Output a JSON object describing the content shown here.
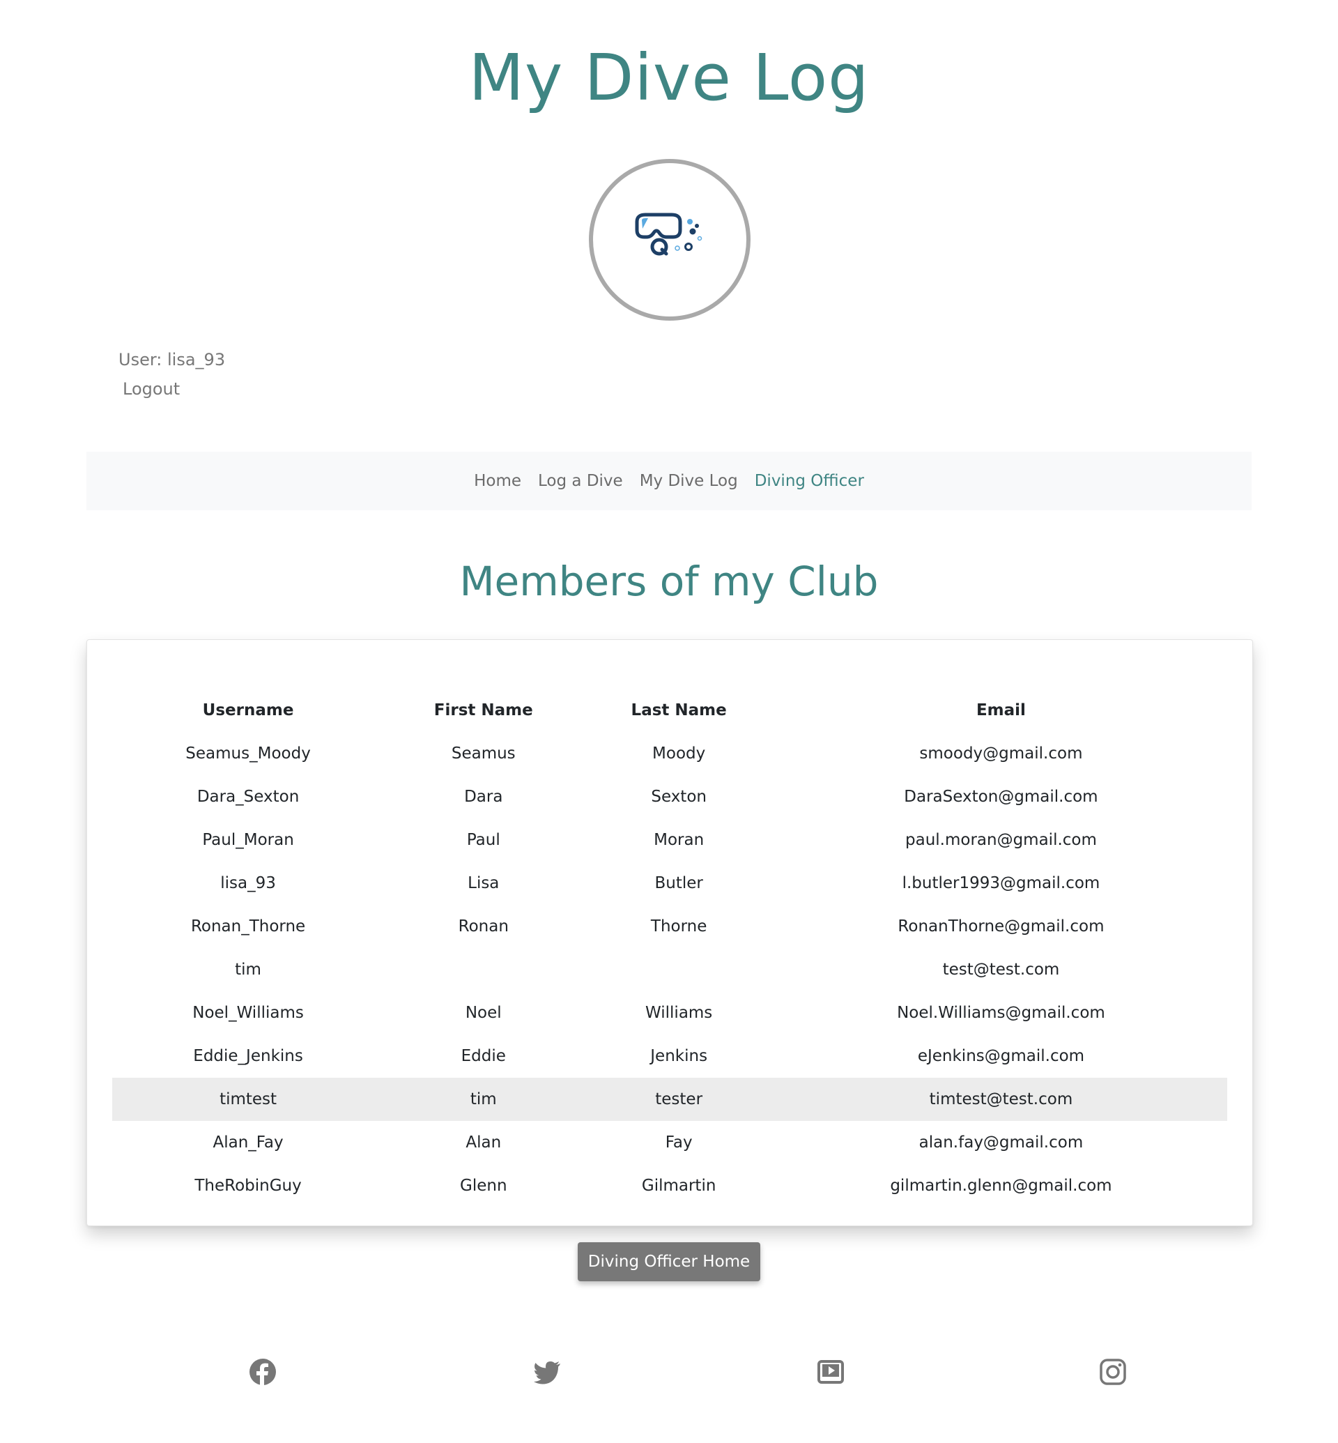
{
  "header": {
    "title": "My Dive Log"
  },
  "user": {
    "label": "User: lisa_93",
    "logout": "Logout"
  },
  "nav": {
    "items": [
      {
        "label": "Home"
      },
      {
        "label": "Log a Dive"
      },
      {
        "label": "My Dive Log"
      },
      {
        "label": "Diving Officer"
      }
    ],
    "active": "Diving Officer"
  },
  "main": {
    "title": "Members of my Club",
    "table": {
      "headers": [
        "Username",
        "First Name",
        "Last Name",
        "Email"
      ],
      "rows": [
        [
          "Seamus_Moody",
          "Seamus",
          "Moody",
          "smoody@gmail.com"
        ],
        [
          "Dara_Sexton",
          "Dara",
          "Sexton",
          "DaraSexton@gmail.com"
        ],
        [
          "Paul_Moran",
          "Paul",
          "Moran",
          "paul.moran@gmail.com"
        ],
        [
          "lisa_93",
          "Lisa",
          "Butler",
          "l.butler1993@gmail.com"
        ],
        [
          "Ronan_Thorne",
          "Ronan",
          "Thorne",
          "RonanThorne@gmail.com"
        ],
        [
          "tim",
          "",
          "",
          "test@test.com"
        ],
        [
          "Noel_Williams",
          "Noel",
          "Williams",
          "Noel.Williams@gmail.com"
        ],
        [
          "Eddie_Jenkins",
          "Eddie",
          "Jenkins",
          "eJenkins@gmail.com"
        ],
        [
          "timtest",
          "tim",
          "tester",
          "timtest@test.com"
        ],
        [
          "Alan_Fay",
          "Alan",
          "Fay",
          "alan.fay@gmail.com"
        ],
        [
          "TheRobinGuy",
          "Glenn",
          "Gilmartin",
          "gilmartin.glenn@gmail.com"
        ]
      ],
      "highlighted_row": "timtest"
    },
    "button_label": "Diving Officer Home"
  },
  "footer": {
    "icons": [
      "facebook-icon",
      "twitter-icon",
      "youtube-icon",
      "instagram-icon"
    ]
  },
  "colors": {
    "accent": "#3f8583",
    "nav_bg": "#f8f9fa",
    "button_bg": "#787878",
    "icon_gray": "#777777",
    "row_highlight": "#ececec"
  }
}
